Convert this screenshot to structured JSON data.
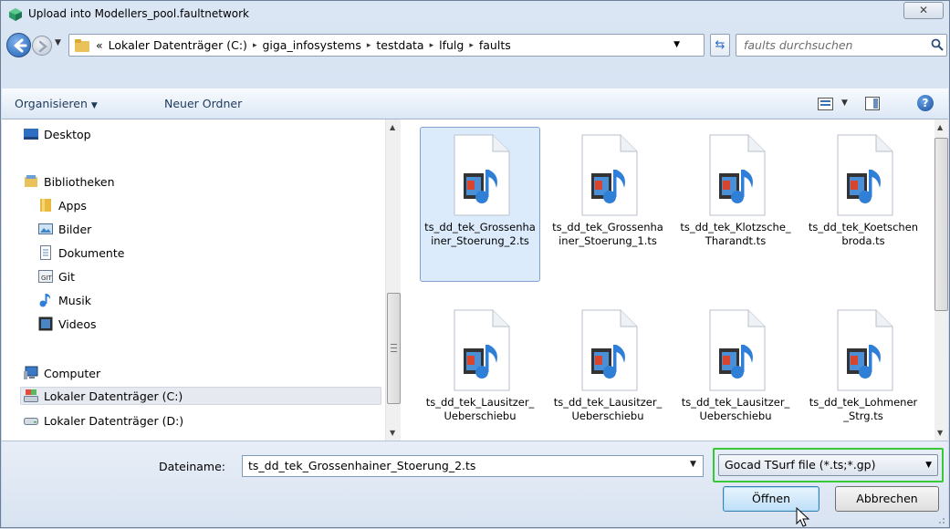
{
  "window": {
    "title": "Upload into Modellers_pool.faultnetwork",
    "close_label": "✕"
  },
  "address": {
    "overflow_label": "«",
    "crumbs": [
      "Lokaler Datenträger (C:)",
      "giga_infosystems",
      "testdata",
      "lfulg",
      "faults"
    ],
    "separator": "▸"
  },
  "search": {
    "placeholder": "faults durchsuchen"
  },
  "toolbar": {
    "organize_label": "Organisieren",
    "new_folder_label": "Neuer Ordner",
    "caret": "▼"
  },
  "nav_pane": {
    "items": [
      {
        "label": "Desktop",
        "icon": "desktop-icon"
      },
      {
        "label": "Bibliotheken",
        "icon": "libraries-icon"
      },
      {
        "label": "Apps",
        "icon": "folder-icon"
      },
      {
        "label": "Bilder",
        "icon": "pictures-icon"
      },
      {
        "label": "Dokumente",
        "icon": "documents-icon"
      },
      {
        "label": "Git",
        "icon": "git-icon"
      },
      {
        "label": "Musik",
        "icon": "music-icon"
      },
      {
        "label": "Videos",
        "icon": "videos-icon"
      },
      {
        "label": "Computer",
        "icon": "computer-icon"
      },
      {
        "label": "Lokaler Datenträger (C:)",
        "icon": "drive-c-icon",
        "selected": true
      },
      {
        "label": "Lokaler Datenträger (D:)",
        "icon": "drive-icon"
      }
    ]
  },
  "files": [
    {
      "name": "ts_dd_tek_Grossenhainer_Stoerung_2.ts",
      "selected": true
    },
    {
      "name": "ts_dd_tek_Grossenhainer_Stoerung_1.ts"
    },
    {
      "name": "ts_dd_tek_Klotzsche_Tharandt.ts"
    },
    {
      "name": "ts_dd_tek_Koetschenbroda.ts"
    },
    {
      "name": "ts_dd_tek_Lausitzer_Ueberschiebu"
    },
    {
      "name": "ts_dd_tek_Lausitzer_Ueberschiebu"
    },
    {
      "name": "ts_dd_tek_Lausitzer_Ueberschiebu"
    },
    {
      "name": "ts_dd_tek_Lohmener_Strg.ts"
    }
  ],
  "footer": {
    "filename_label": "Dateiname:",
    "filename_value": "ts_dd_tek_Grossenhainer_Stoerung_2.ts",
    "filter_value": "Gocad TSurf file (*.ts;*.gp)",
    "open_label": "Öffnen",
    "cancel_label": "Abbrechen"
  },
  "colors": {
    "highlight_border": "#37c837",
    "selection": "#dcebfc"
  }
}
